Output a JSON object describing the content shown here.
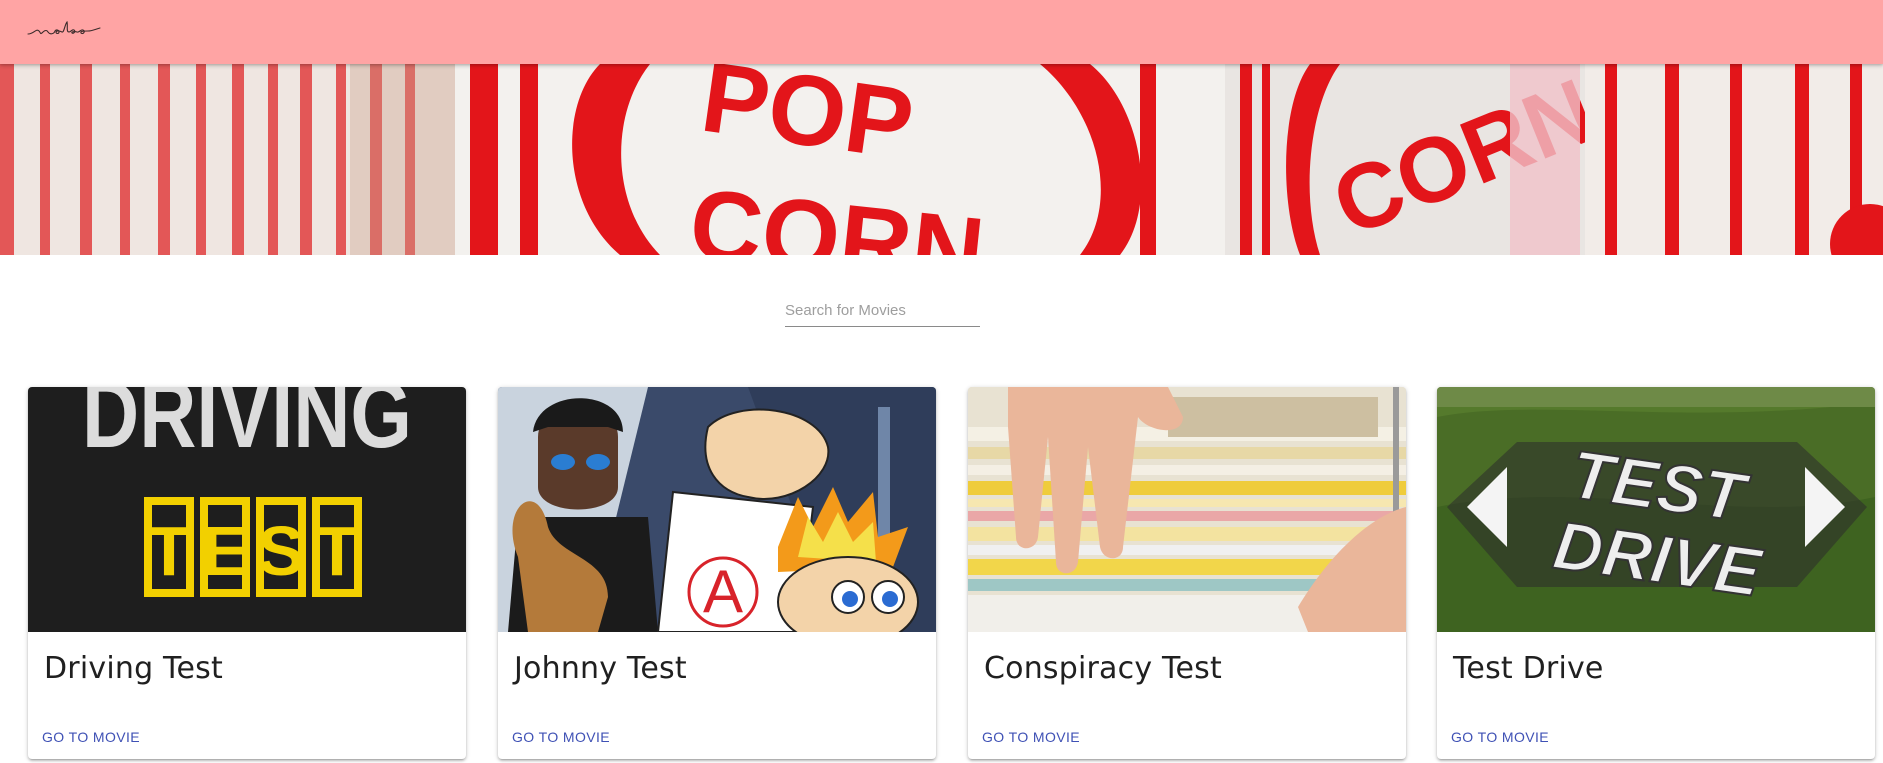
{
  "app": {
    "logo_text": "nobo",
    "colors": {
      "appbar": "#ffa4a4",
      "accent": "#3f51b5",
      "popcorn_red": "#e3151a"
    }
  },
  "hero": {
    "image": "popcorn-boxes-banner"
  },
  "search": {
    "placeholder": "Search for Movies",
    "value": ""
  },
  "movies": [
    {
      "title": "Driving Test",
      "action": "GO TO MOVIE",
      "poster": "driving-test-poster"
    },
    {
      "title": "Johnny Test",
      "action": "GO TO MOVIE",
      "poster": "johnny-test-poster"
    },
    {
      "title": "Conspiracy Test",
      "action": "GO TO MOVIE",
      "poster": "file-folders-photo"
    },
    {
      "title": "Test Drive",
      "action": "GO TO MOVIE",
      "poster": "test-drive-logo"
    }
  ],
  "poster_text": {
    "driving": "DRIVING",
    "test_letters": [
      "T",
      "E",
      "S",
      "T"
    ],
    "testdrive_top": "TEST",
    "testdrive_bottom": "DRIVE"
  }
}
